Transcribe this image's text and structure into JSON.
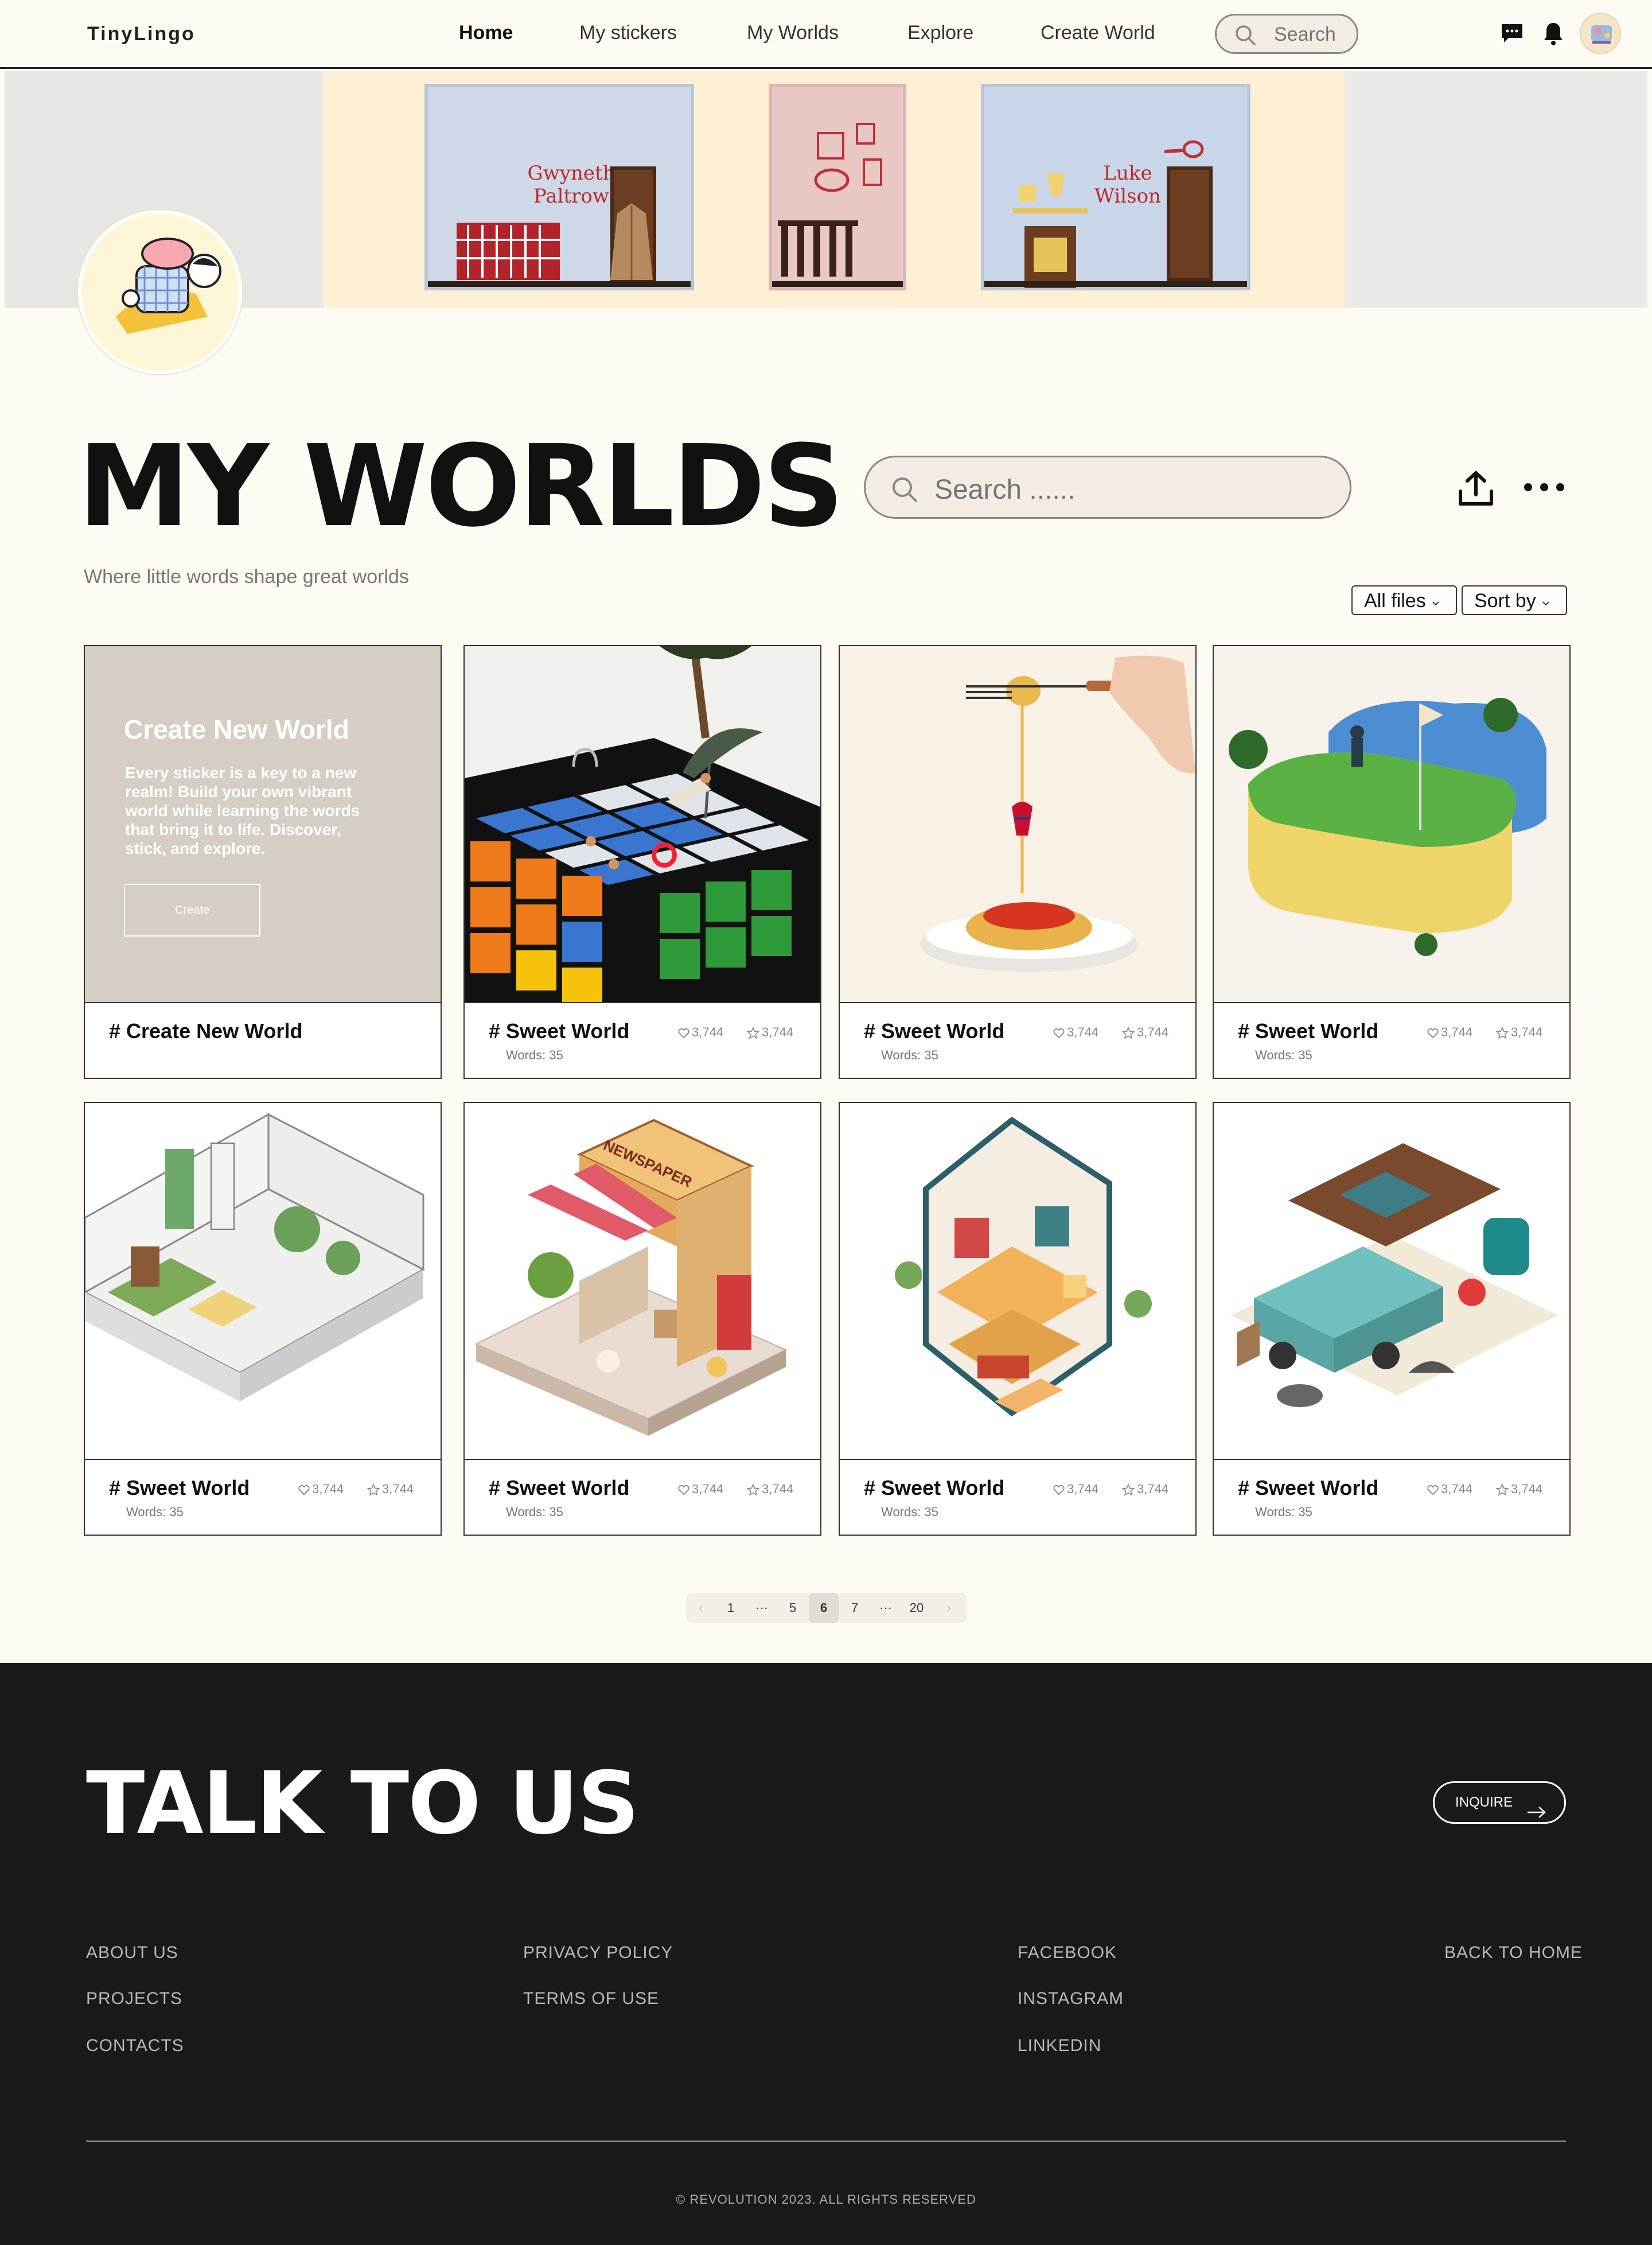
{
  "nav": {
    "brand": "TinyLingo",
    "links": [
      "Home",
      "My stickers",
      "My Worlds",
      "Explore",
      "Create World"
    ],
    "search_placeholder": "Search"
  },
  "banner": {
    "rooms": [
      {
        "label_line1": "Gwyneth",
        "label_line2": "Paltrow"
      },
      {
        "label_line1": "",
        "label_line2": ""
      },
      {
        "label_line1": "Luke",
        "label_line2": "Wilson"
      }
    ]
  },
  "page": {
    "title": "MY WORLDS",
    "subtitle": "Where little words shape great worlds",
    "search_placeholder": "Search ......",
    "filter_label": "All files",
    "sort_label": "Sort by"
  },
  "create_card": {
    "heading": "Create New World",
    "text": "Every sticker is a key to a new realm! Build your own vibrant world while learning the words that bring it to life. Discover, stick, and explore.",
    "button": "Create",
    "footer_title": "# Create New World"
  },
  "worlds": [
    {
      "title": "# Sweet World",
      "words": "Words: 35",
      "likes": "3,744",
      "stars": "3,744",
      "scene": "rubik-pool"
    },
    {
      "title": "# Sweet World",
      "words": "Words: 35",
      "likes": "3,744",
      "stars": "3,744",
      "scene": "spaghetti"
    },
    {
      "title": "# Sweet World",
      "words": "Words: 35",
      "likes": "3,744",
      "stars": "3,744",
      "scene": "sponge-golf"
    },
    {
      "title": "# Sweet World",
      "words": "Words: 35",
      "likes": "3,744",
      "stars": "3,744",
      "scene": "iso-room"
    },
    {
      "title": "# Sweet World",
      "words": "Words: 35",
      "likes": "3,744",
      "stars": "3,744",
      "scene": "newspaper-stand"
    },
    {
      "title": "# Sweet World",
      "words": "Words: 35",
      "likes": "3,744",
      "stars": "3,744",
      "scene": "iso-house"
    },
    {
      "title": "# Sweet World",
      "words": "Words: 35",
      "likes": "3,744",
      "stars": "3,744",
      "scene": "camper-van"
    }
  ],
  "newspaper_sign": "NEWSPAPER",
  "pagination": {
    "prev": "‹",
    "items": [
      "1",
      "···",
      "5",
      "6",
      "7",
      "···",
      "20"
    ],
    "current": "6",
    "next": "›"
  },
  "footer": {
    "headline": "TALK TO US",
    "inquire": "INQUIRE",
    "col1": [
      "ABOUT US",
      "PROJECTS",
      "CONTACTS"
    ],
    "col2": [
      "PRIVACY POLICY",
      "TERMS OF USE"
    ],
    "col3": [
      "FACEBOOK",
      "INSTAGRAM",
      "LINKEDIN"
    ],
    "back_home": "BACK TO HOME",
    "copyright": "© REVOLUTION 2023. ALL RIGHTS RESERVED"
  },
  "icons": {
    "nav": [
      "search-icon",
      "chat-icon",
      "bell-icon"
    ],
    "page": [
      "search-icon",
      "share-icon",
      "more-icon"
    ],
    "card": [
      "heart-icon",
      "star-icon"
    ],
    "footer": [
      "arrow-right-icon"
    ]
  },
  "colors": {
    "page_bg": "#fefbf4",
    "footer_bg": "#1b1a1a",
    "create_panel": "#d5cec4",
    "banner_center": "#fdf0d4"
  }
}
